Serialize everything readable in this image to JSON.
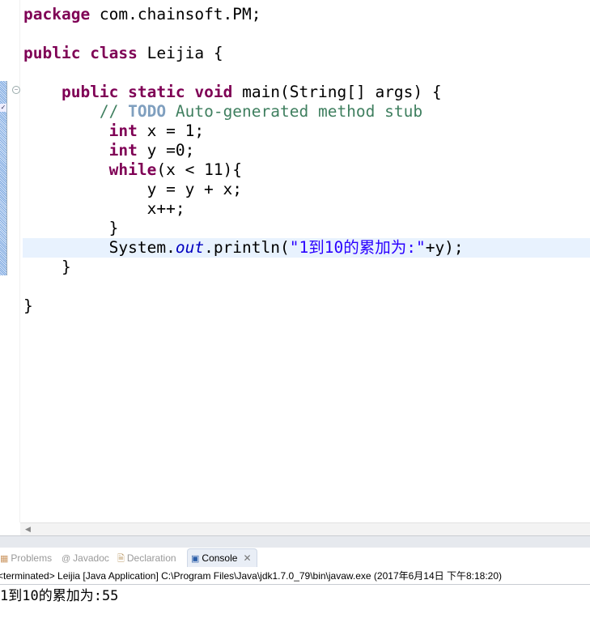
{
  "editor": {
    "lines": [
      [
        [
          "package",
          "kw"
        ],
        [
          " com.chainsoft.PM;",
          ""
        ]
      ],
      [],
      [
        [
          "public",
          "kw"
        ],
        [
          " ",
          ""
        ],
        [
          "class",
          "kw"
        ],
        [
          " Leijia {",
          ""
        ]
      ],
      [],
      [
        [
          "    ",
          ""
        ],
        [
          "public",
          "kw"
        ],
        [
          " ",
          ""
        ],
        [
          "static",
          "kw"
        ],
        [
          " ",
          ""
        ],
        [
          "void",
          "kw"
        ],
        [
          " main(String[] args) {",
          ""
        ]
      ],
      [
        [
          "        ",
          ""
        ],
        [
          "// ",
          "cm"
        ],
        [
          "TODO",
          "todo"
        ],
        [
          " Auto-generated method stub",
          "cm"
        ]
      ],
      [
        [
          "         ",
          ""
        ],
        [
          "int",
          "kw"
        ],
        [
          " x = 1;",
          ""
        ]
      ],
      [
        [
          "         ",
          ""
        ],
        [
          "int",
          "kw"
        ],
        [
          " y =0;",
          ""
        ]
      ],
      [
        [
          "         ",
          ""
        ],
        [
          "while",
          "kw"
        ],
        [
          "(x < 11){",
          ""
        ]
      ],
      [
        [
          "             y = y + x;",
          ""
        ]
      ],
      [
        [
          "             x++;",
          ""
        ]
      ],
      [
        [
          "         }",
          ""
        ]
      ],
      [
        [
          "         System.",
          ""
        ],
        [
          "out",
          "fld"
        ],
        [
          ".println(",
          ""
        ],
        [
          "\"1到10的累加为:\"",
          "str"
        ],
        [
          "+y);",
          ""
        ]
      ],
      [
        [
          "    }",
          ""
        ]
      ],
      [],
      [
        [
          "}",
          ""
        ]
      ]
    ],
    "highlighted_line": 12
  },
  "panel": {
    "tabs": [
      {
        "label": "Problems",
        "icon": "problems-icon"
      },
      {
        "label": "Javadoc",
        "icon": "at-icon"
      },
      {
        "label": "Declaration",
        "icon": "declaration-icon"
      },
      {
        "label": "Console",
        "icon": "console-icon",
        "active": true
      }
    ],
    "status": "<terminated> Leijia [Java Application] C:\\Program Files\\Java\\jdk1.7.0_79\\bin\\javaw.exe (2017年6月14日 下午8:18:20)",
    "output": "1到10的累加为:55"
  }
}
